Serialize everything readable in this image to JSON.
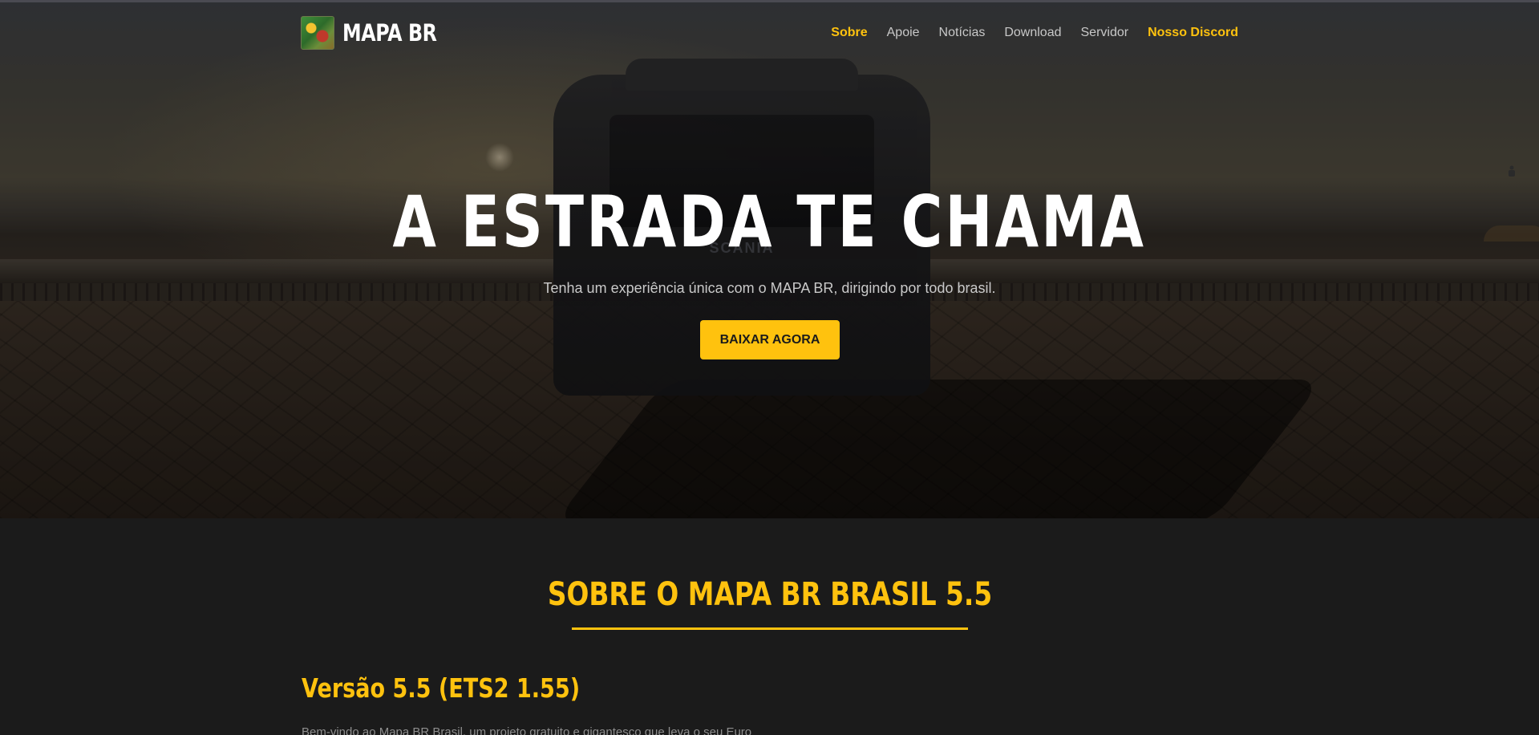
{
  "nav": {
    "brand": "MAPA BR",
    "logo_icon": "mapa-br-logo",
    "items": [
      {
        "label": "Sobre",
        "state": "active"
      },
      {
        "label": "Apoie",
        "state": "default"
      },
      {
        "label": "Notícias",
        "state": "default"
      },
      {
        "label": "Download",
        "state": "default"
      },
      {
        "label": "Servidor",
        "state": "default"
      },
      {
        "label": "Nosso Discord",
        "state": "accent"
      }
    ]
  },
  "hero": {
    "title": "A ESTRADA TE CHAMA",
    "subtitle": "Tenha um experiência única com o MAPA BR, dirigindo por todo brasil.",
    "cta_label": "BAIXAR AGORA",
    "truck_brand": "SCANIA"
  },
  "about": {
    "title": "SOBRE O MAPA BR BRASIL 5.5",
    "version_title": "Versão 5.5 (ETS2 1.55)",
    "intro": "Bem-vindo ao Mapa BR Brasil, um projeto gratuito e gigantesco que leva o seu Euro"
  },
  "colors": {
    "accent": "#ffc20e",
    "background": "#1b1b1b",
    "nav_text": "#c8c8c8"
  }
}
